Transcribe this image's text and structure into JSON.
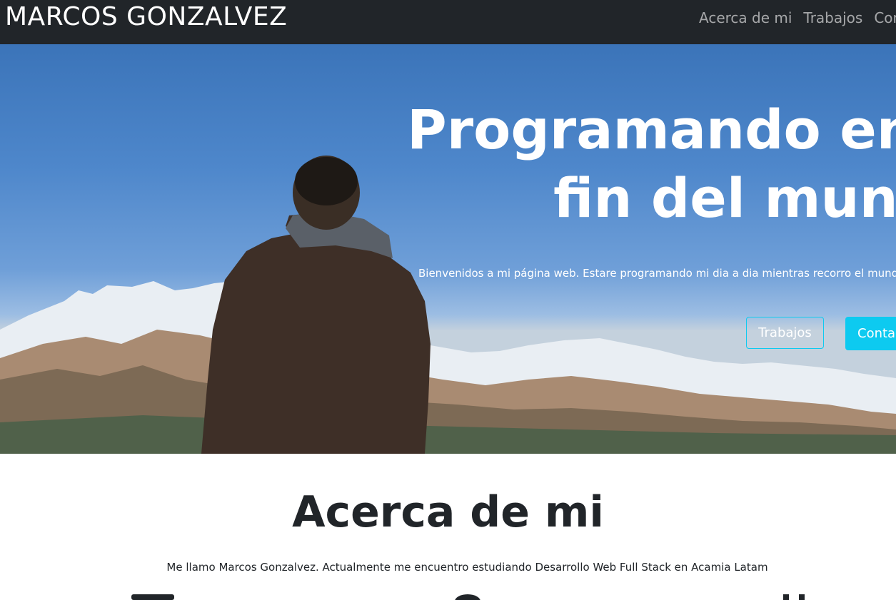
{
  "navbar": {
    "brand": "MARCOS GONZALVEZ",
    "links": [
      "Acerca de mi",
      "Trabajos",
      "Contacto"
    ]
  },
  "hero": {
    "title_line1": "Programando en el",
    "title_line2": "fin del mundo",
    "subtitle": "Bienvenidos a mi página web. Estare programando mi dia a dia mientras recorro el mundo en mi camioneta",
    "buttons": {
      "works": "Trabajos",
      "contact": "Contacto"
    }
  },
  "about": {
    "title": "Acerca de mi",
    "text": "Me llamo Marcos Gonzalvez. Actualmente me encuentro estudiando Desarrollo Web Full Stack en Acamia Latam"
  },
  "colors": {
    "navbar": "#212529",
    "accent": "#0dcaf0",
    "text": "#212529"
  }
}
